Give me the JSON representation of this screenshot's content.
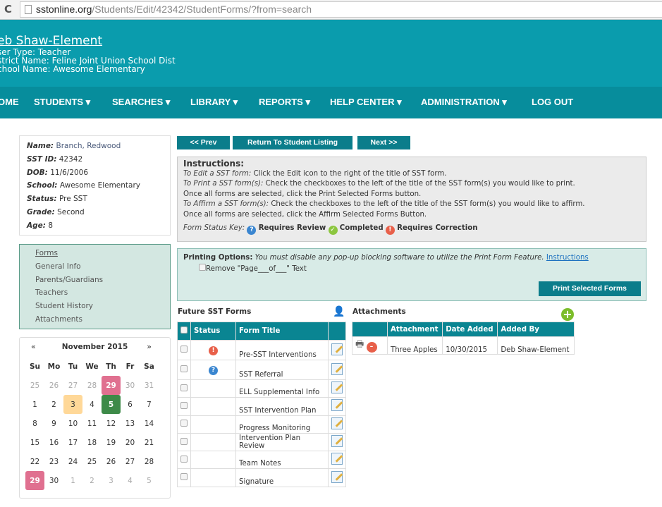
{
  "browser": {
    "url_domain": "sstonline.org",
    "url_path": "/Students/Edit/42342/StudentForms/?from=search"
  },
  "header": {
    "user_name": "eb Shaw-Element",
    "user_type": "ser Type: Teacher",
    "district": "strict Name: Feline Joint Union School Dist",
    "school": "chool Name: Awesome Elementary",
    "brand_color": "#0a9cad"
  },
  "nav": [
    {
      "label": "OME"
    },
    {
      "label": "STUDENTS ▾"
    },
    {
      "label": "SEARCHES ▾"
    },
    {
      "label": "LIBRARY ▾"
    },
    {
      "label": "REPORTS ▾"
    },
    {
      "label": "HELP CENTER ▾"
    },
    {
      "label": "ADMINISTRATION ▾"
    },
    {
      "label": "LOG OUT"
    }
  ],
  "student": [
    {
      "k": "Name:",
      "v": "Branch, Redwood"
    },
    {
      "k": "SST ID:",
      "v": "42342"
    },
    {
      "k": "DOB:",
      "v": "11/6/2006"
    },
    {
      "k": "School:",
      "v": "Awesome Elementary"
    },
    {
      "k": "Status:",
      "v": "Pre SST"
    },
    {
      "k": "Grade:",
      "v": "Second"
    },
    {
      "k": "Age:",
      "v": "8"
    }
  ],
  "side_nav": [
    {
      "label": "Forms",
      "active": true
    },
    {
      "label": "General Info"
    },
    {
      "label": "Parents/Guardians"
    },
    {
      "label": "Teachers"
    },
    {
      "label": "Student History"
    },
    {
      "label": "Attachments"
    }
  ],
  "calendar": {
    "prev": "«",
    "next": "»",
    "title": "November 2015",
    "days": [
      "Su",
      "Mo",
      "Tu",
      "We",
      "Th",
      "Fr",
      "Sa"
    ],
    "weeks": [
      [
        "25",
        "26",
        "27",
        "28",
        "29",
        "30",
        "31"
      ],
      [
        "1",
        "2",
        "3",
        "4",
        "5",
        "6",
        "7"
      ],
      [
        "8",
        "9",
        "10",
        "11",
        "12",
        "13",
        "14"
      ],
      [
        "15",
        "16",
        "17",
        "18",
        "19",
        "20",
        "21"
      ],
      [
        "22",
        "23",
        "24",
        "25",
        "26",
        "27",
        "28"
      ],
      [
        "29",
        "30",
        "1",
        "2",
        "3",
        "4",
        "5"
      ]
    ],
    "highlights": {
      "29": "#e07090",
      "3": "#ffd898",
      "5": "#3d8a48"
    }
  },
  "buttons": {
    "prev": "<< Prev",
    "return": "Return To Student Listing",
    "next": "Next >>",
    "print_selected": "Print Selected Forms"
  },
  "instructions": {
    "title": "Instructions:",
    "lines": [
      {
        "em": "To Edit a SST form:",
        "text": " Click the Edit icon to the right of the title of SST form."
      },
      {
        "em": "To Print a SST form(s):",
        "text": " Check the checkboxes to the left of the title of the SST form(s) you would like to print."
      },
      {
        "em": "",
        "text": "Once all forms are selected, click the Print Selected Forms button."
      },
      {
        "em": "To Affirm a SST form(s):",
        "text": " Check the checkboxes to the left of the title of the SST form(s) you would like to affirm."
      },
      {
        "em": "",
        "text": "Once all forms are selected, click the Affirm Selected Forms Button."
      }
    ],
    "key_label": "Form Status Key:",
    "key_review": "Requires Review",
    "key_completed": "Completed",
    "key_correction": "Requires Correction"
  },
  "printing": {
    "label": "Printing Options:",
    "note": " You must disable any pop-up blocking software to utilize the Print Form Feature. ",
    "link": "Instructions",
    "remove_label": "Remove \"Page___of___\" Text"
  },
  "forms": {
    "title": "Future SST Forms",
    "col_status": "Status",
    "col_title": "Form Title",
    "rows": [
      {
        "title": "Pre-SST Interventions",
        "status": "correction"
      },
      {
        "title": "SST Referral",
        "status": "review"
      },
      {
        "title": "ELL Supplemental Info",
        "status": ""
      },
      {
        "title": "SST Intervention Plan",
        "status": ""
      },
      {
        "title": "Progress Monitoring",
        "status": ""
      },
      {
        "title": "Intervention Plan Review",
        "status": ""
      },
      {
        "title": "Team Notes",
        "status": ""
      },
      {
        "title": "Signature",
        "status": ""
      }
    ]
  },
  "attachments": {
    "title": "Attachments",
    "cols": [
      "Attachment",
      "Date Added",
      "Added By"
    ],
    "rows": [
      {
        "name": "Three Apples",
        "date": "10/30/2015",
        "by": "Deb Shaw-Element"
      }
    ]
  }
}
